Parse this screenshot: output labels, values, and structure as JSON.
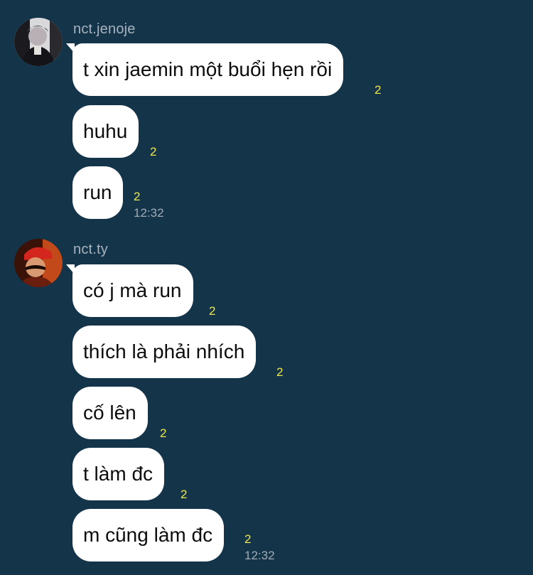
{
  "theme": {
    "background": "#143449",
    "bubble": "#ffffff",
    "read_count_color": "#f1e74a",
    "sender_name_color": "#a7b3bf"
  },
  "chat": {
    "groups": [
      {
        "sender": "nct.jenoje",
        "avatar_icon": "user-avatar-icon",
        "messages": [
          {
            "text": "t xin jaemin một buổi hẹn rồi",
            "read_count": "2",
            "time": ""
          },
          {
            "text": "huhu",
            "read_count": "2",
            "time": ""
          },
          {
            "text": "run",
            "read_count": "2",
            "time": "12:32"
          }
        ]
      },
      {
        "sender": "nct.ty",
        "avatar_icon": "user-avatar-icon",
        "messages": [
          {
            "text": "có j mà run",
            "read_count": "2",
            "time": ""
          },
          {
            "text": "thích là phải nhích",
            "read_count": "2",
            "time": ""
          },
          {
            "text": "cố lên",
            "read_count": "2",
            "time": ""
          },
          {
            "text": "t làm đc",
            "read_count": "2",
            "time": ""
          },
          {
            "text": "m cũng làm đc",
            "read_count": "2",
            "time": "12:32"
          }
        ]
      }
    ]
  }
}
